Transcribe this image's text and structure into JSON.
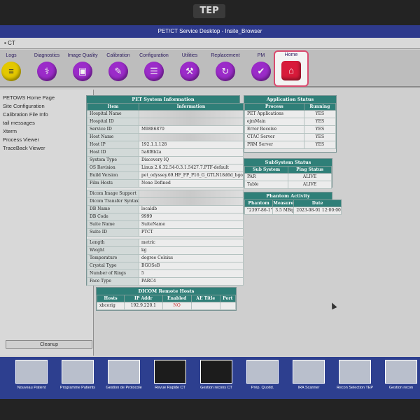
{
  "bezel_logo": "TEP",
  "window_title": "PET/CT Service Desktop - Insite_Browser",
  "menubar_label": "CT",
  "toolbar": [
    {
      "label": "Logs",
      "icon": "logs-icon",
      "glyph": "≡",
      "color": "yellow"
    },
    {
      "label": "Diagnostics",
      "icon": "stethoscope-icon",
      "glyph": "⚕"
    },
    {
      "label": "Image Quality",
      "icon": "image-quality-icon",
      "glyph": "▣"
    },
    {
      "label": "Calibration",
      "icon": "calibration-icon",
      "glyph": "✎"
    },
    {
      "label": "Configuration",
      "icon": "configuration-icon",
      "glyph": "☰"
    },
    {
      "label": "Utilities",
      "icon": "utilities-icon",
      "glyph": "⚒"
    },
    {
      "label": "Replacement",
      "icon": "replacement-icon",
      "glyph": "↻"
    },
    {
      "label": "PM",
      "icon": "pm-icon",
      "glyph": "✔"
    },
    {
      "label": "Home",
      "icon": "home-icon",
      "glyph": "⌂",
      "color": "red"
    }
  ],
  "nav_items": [
    "PETOWS Home Page",
    "Site Configuration",
    "Calibration File Info",
    "tail messages",
    "Xterm",
    "Process Viewer",
    "TraceBack Viewer"
  ],
  "cleanup_label": "Cleanup",
  "pet_system_info": {
    "title": "PET System Information",
    "col_item": "Item",
    "col_info": "Information",
    "rows1": [
      {
        "item": "Hospital Name",
        "info": "",
        "blur": true
      },
      {
        "item": "Hospital ID",
        "info": "",
        "blur": true
      },
      {
        "item": "Service ID",
        "info": "M9886870"
      },
      {
        "item": "Host Name",
        "info": "",
        "blur": true
      },
      {
        "item": "Host IP",
        "info": "192.1.1.128"
      },
      {
        "item": "Host ID",
        "info": "5a8f8b2a"
      },
      {
        "item": "System Type",
        "info": "Discovery IQ"
      },
      {
        "item": "OS Revision",
        "info": "Linux 2.6.32.54-0.3.1.5427.7.PTF-default"
      },
      {
        "item": "Build Version",
        "info": "pet_odyssey.69.HF_FP_P16_G_GTLN18d6d_bgo"
      },
      {
        "item": "Film Hosts",
        "info": "None Defined"
      }
    ],
    "rows2": [
      {
        "item": "Dicom Image Support",
        "info": "",
        "blur": true
      },
      {
        "item": "Dicom Transfer Syntax",
        "info": "",
        "blur": true
      },
      {
        "item": "DB Name",
        "info": "localdb"
      },
      {
        "item": "DB Code",
        "info": "9999"
      },
      {
        "item": "Suite Name",
        "info": "SuiteName"
      },
      {
        "item": "Suite ID",
        "info": "PTCT"
      }
    ],
    "rows3": [
      {
        "item": "Length",
        "info": "metric"
      },
      {
        "item": "Weight",
        "info": "kg"
      },
      {
        "item": "Temperature",
        "info": "degree Celsius"
      },
      {
        "item": "Crystal Type",
        "info": "BGOSeB"
      },
      {
        "item": "Number of Rings",
        "info": "5"
      },
      {
        "item": "Face Type",
        "info": "PARC4"
      }
    ]
  },
  "dicom_remote": {
    "title": "DICOM Remote Hosts",
    "cols": [
      "Hosts",
      "IP Addr",
      "Enabled",
      "AE Title",
      "Port"
    ],
    "rows": [
      {
        "host": "xbcorig",
        "ip": "192.9.220.1",
        "enabled": "NO",
        "ae": "",
        "port": ""
      }
    ]
  },
  "app_status": {
    "title": "Application Status",
    "cols": [
      "Process",
      "Running"
    ],
    "rows": [
      {
        "process": "PET Applications",
        "running": "YES"
      },
      {
        "process": "ejmMain",
        "running": "YES"
      },
      {
        "process": "Error Receive",
        "running": "YES"
      },
      {
        "process": "CTAC Server",
        "running": "YES"
      },
      {
        "process": "PRM Server",
        "running": "YES"
      }
    ]
  },
  "subsystem_status": {
    "title": "SubSystem Status",
    "cols": [
      "Sub System",
      "Ping Status"
    ],
    "rows": [
      {
        "name": "PAR",
        "status": "ALIVE"
      },
      {
        "name": "Table",
        "status": "ALIVE"
      }
    ]
  },
  "phantom_activity": {
    "title": "Phantom Activity",
    "cols": [
      "Phantom",
      "Measure",
      "Date"
    ],
    "rows": [
      {
        "phantom": "\"2397-86-1\"",
        "measure": "3.5 MBq",
        "date": "2023-08-01 12:00:00"
      }
    ]
  },
  "taskbar": [
    {
      "label": "Nouveau Patient",
      "icon": "new-patient-icon"
    },
    {
      "label": "Programme Patients",
      "icon": "patient-schedule-icon"
    },
    {
      "label": "Gestion de Protocole",
      "icon": "protocol-management-icon"
    },
    {
      "label": "Revue Rapide CT",
      "icon": "ct-review-icon",
      "dark": true
    },
    {
      "label": "Gestion recons CT",
      "icon": "ct-recon-icon",
      "dark": true
    },
    {
      "label": "Prép. Quotid.",
      "icon": "daily-prep-icon"
    },
    {
      "label": "IRA Scanner",
      "icon": "scanner-icon"
    },
    {
      "label": "Recon Selection TEP",
      "icon": "pet-recon-icon"
    },
    {
      "label": "Gestion recon",
      "icon": "recon-management-icon"
    }
  ]
}
